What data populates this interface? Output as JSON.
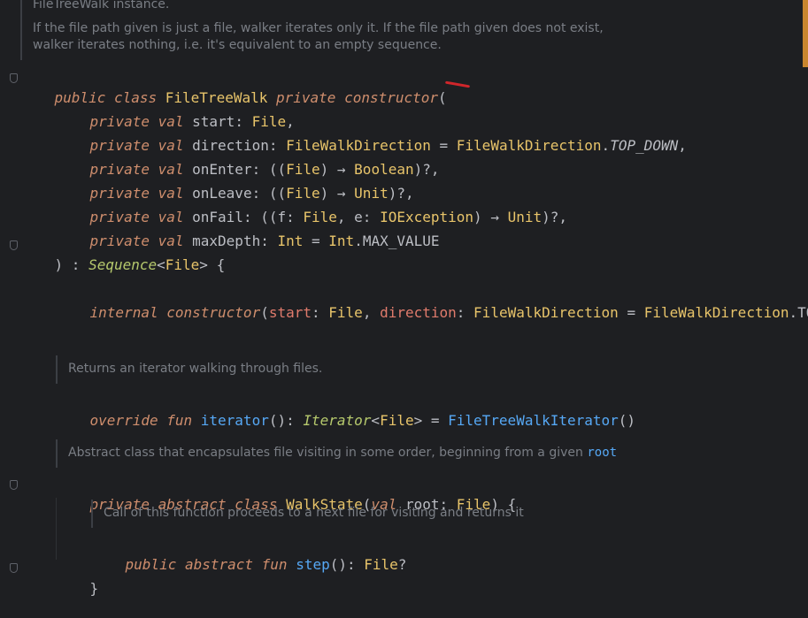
{
  "doc_header": {
    "title_fragment": "FileTreeWalk instance.",
    "line1": "If the file path given is just a file, walker iterates only it. If the file path given does not exist,",
    "line2": "walker iterates nothing, i.e. it's equivalent to an empty sequence."
  },
  "code": {
    "l1": {
      "kw1": "public class",
      "name": "FileTreeWalk",
      "kw2": "private constructor",
      "punc": "("
    },
    "start": {
      "kw": "private val",
      "name": "start",
      "sep": ": ",
      "type": "File",
      "end": ","
    },
    "direction": {
      "kw": "private val",
      "name": "direction",
      "sep": ": ",
      "type": "FileWalkDirection",
      "eq": " = ",
      "enum": "FileWalkDirection",
      "dot": ".",
      "const": "TOP_DOWN",
      "end": ","
    },
    "onEnter": {
      "kw": "private val",
      "name": "onEnter",
      "sep": ": ",
      "p1": "((",
      "t1": "File",
      "p2": ") → ",
      "t2": "Boolean",
      "end": ")?,"
    },
    "onLeave": {
      "kw": "private val",
      "name": "onLeave",
      "sep": ": ",
      "p1": "((",
      "t1": "File",
      "p2": ") → ",
      "t2": "Unit",
      "end": ")?,"
    },
    "onFail": {
      "kw": "private val",
      "name": "onFail",
      "sep": ": ",
      "p1": "((f: ",
      "t1": "File",
      "p2": ", e: ",
      "t2": "IOException",
      "p3": ") → ",
      "t3": "Unit",
      "end": ")?,"
    },
    "maxDepth": {
      "kw": "private val",
      "name": "maxDepth",
      "sep": ": ",
      "type": "Int",
      "eq": " = ",
      "t2": "Int",
      "rest": ".MAX_VALUE"
    },
    "close": {
      "p1": ") : ",
      "type": "Sequence",
      "lt": "<",
      "t2": "File",
      "rest": "> {"
    },
    "internal": {
      "kw": "internal",
      "sp": " ",
      "kw2": "constructor",
      "p1": "(",
      "param1": "start",
      "c1": ": ",
      "t1": "File",
      "c2": ", ",
      "param2": "direction",
      "c3": ": ",
      "t2": "FileWalkDirection",
      "eq": " = ",
      "t3": "FileWalkDirection",
      "rest": ".TO"
    },
    "doc_iter": "Returns an iterator walking through files.",
    "iterator": {
      "kw": "override fun",
      "sp": " ",
      "fn": "iterator",
      "p1": "(): ",
      "type": "Iterator",
      "lt": "<",
      "t2": "File",
      "p2": "> = ",
      "call": "FileTreeWalkIterator",
      "p3": "()"
    },
    "doc_walk": {
      "text": "Abstract class that encapsulates file visiting in some order, beginning from a given ",
      "code": "root"
    },
    "walkstate": {
      "kw": "private abstract class",
      "sp": " ",
      "name": "WalkState",
      "p1": "(",
      "kw2": "val",
      "sp2": " ",
      "param": "root",
      "c1": ": ",
      "type": "File",
      "p2": ") {"
    },
    "doc_step": "Call of this function proceeds to a next file for visiting and returns it",
    "step": {
      "kw": "public abstract fun",
      "sp": " ",
      "fn": "step",
      "p1": "(): ",
      "type": "File",
      "p2": "?"
    },
    "brace": "}"
  },
  "colors": {
    "background": "#1e1f22",
    "keyword": "#cf8e6d",
    "type": "#e8c46a",
    "function": "#56a8f5",
    "parameter": "#e07b6c",
    "doc": "#7a7e85",
    "scroll_marker": "#c9862f",
    "annotation": "#d0262b"
  }
}
